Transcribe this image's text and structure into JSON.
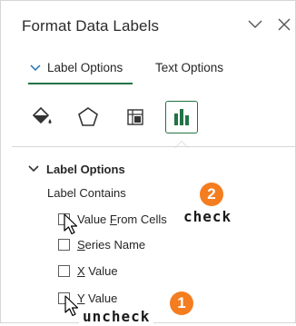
{
  "pane": {
    "title": "Format Data Labels"
  },
  "tabs": [
    {
      "label": "Label Options",
      "active": true
    },
    {
      "label": "Text Options",
      "active": false
    }
  ],
  "category_icons": [
    {
      "name": "fill-line-icon",
      "active": false
    },
    {
      "name": "effects-icon",
      "active": false
    },
    {
      "name": "size-properties-icon",
      "active": false
    },
    {
      "name": "label-options-icon",
      "active": true
    }
  ],
  "section": {
    "title": "Label Options",
    "subheading": "Label Contains"
  },
  "checkboxes": [
    {
      "pre": "Value ",
      "ul": "F",
      "post": "rom Cells",
      "checked": false
    },
    {
      "pre": "",
      "ul": "S",
      "post": "eries Name",
      "checked": false
    },
    {
      "pre": "",
      "ul": "X",
      "post": " Value",
      "checked": false
    },
    {
      "pre": "",
      "ul": "Y",
      "post": " Value",
      "checked": false
    }
  ],
  "annotations": {
    "step1": {
      "number": "1",
      "text": "uncheck"
    },
    "step2": {
      "number": "2",
      "text": "check"
    }
  },
  "colors": {
    "accent": "#217346",
    "badge": "#f47d20"
  }
}
